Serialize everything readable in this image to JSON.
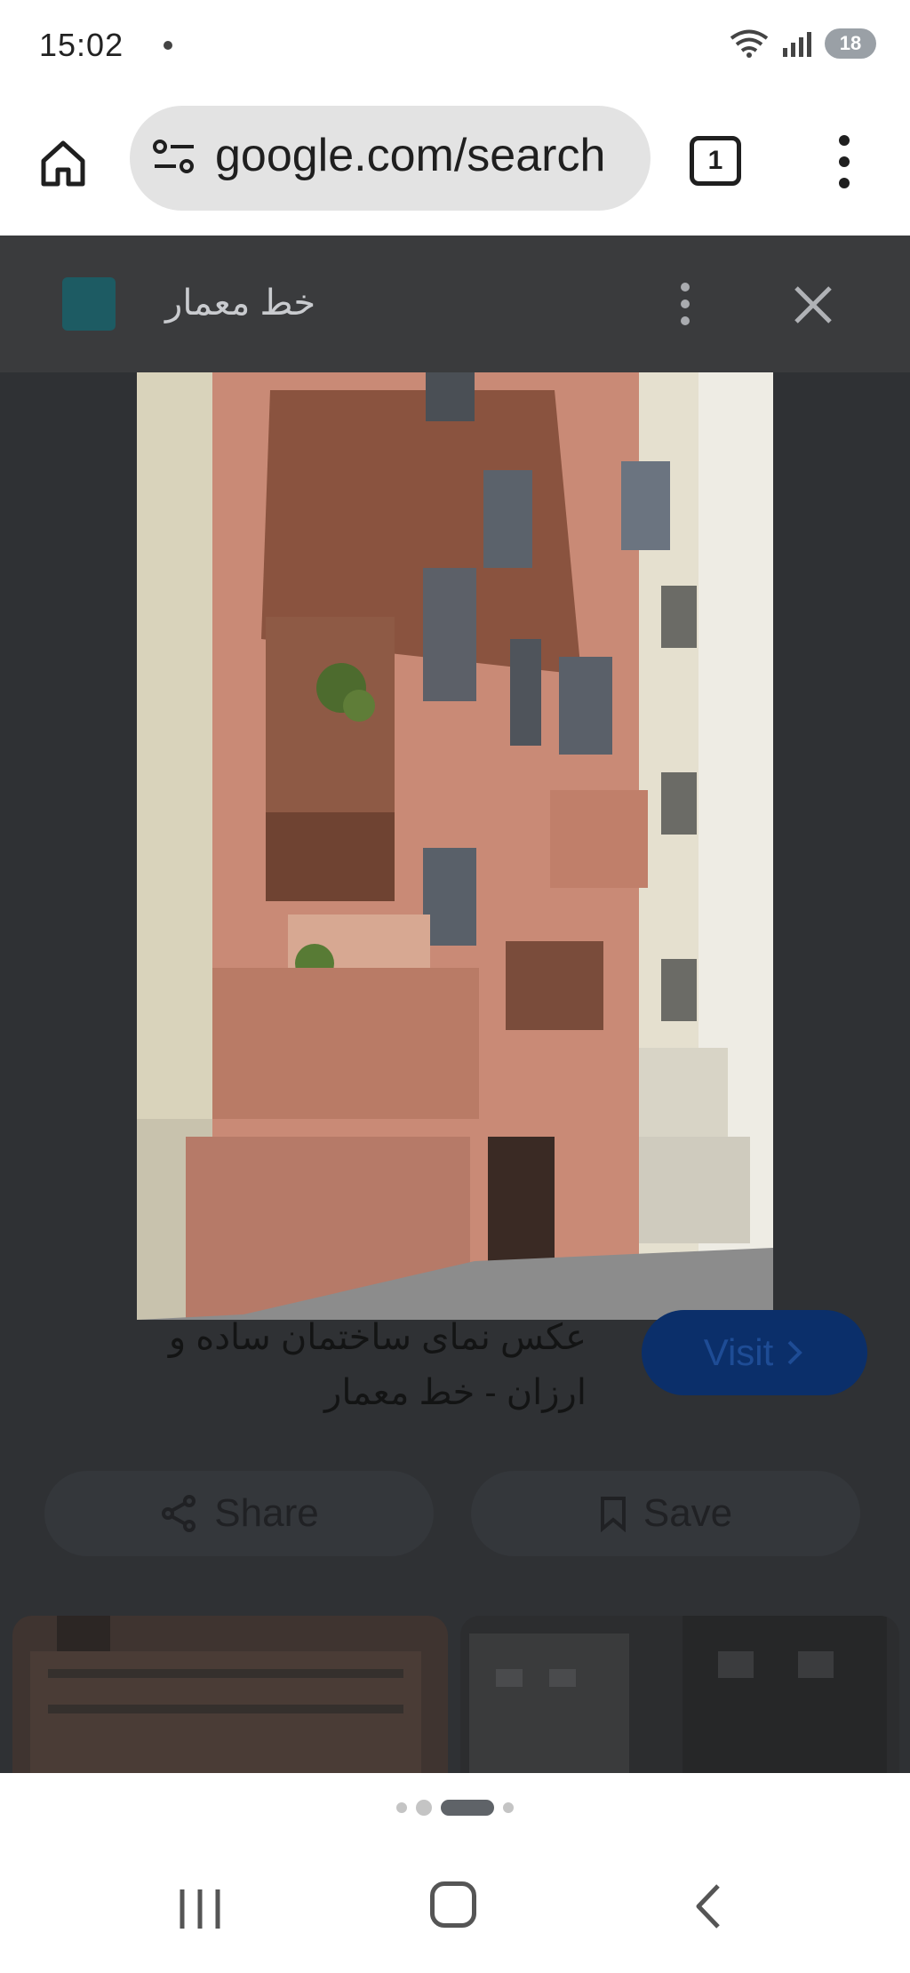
{
  "status_bar": {
    "time": "15:02",
    "battery": "18",
    "icons": [
      "wifi-icon",
      "signal-icon",
      "battery-icon"
    ]
  },
  "toolbar": {
    "url": "google.com/search",
    "tab_count": "1",
    "icons": [
      "home-icon",
      "tune-icon",
      "tab-switcher-icon",
      "more-vert-icon"
    ]
  },
  "viewer": {
    "source_name": "خط معمار",
    "title_line1": "عکس نمای ساختمان ساده و",
    "title_line2": "ارزان - خط معمار",
    "visit_label": "Visit",
    "share_label": "Share",
    "save_label": "Save",
    "icons": [
      "more-vert-icon",
      "close-icon",
      "chevron-right-icon",
      "share-icon",
      "bookmark-icon"
    ]
  },
  "pagination": {
    "count": 4,
    "active_index": 2
  },
  "colors": {
    "url_bar": "#e3e3e3",
    "dim_overlay": "#2f3134",
    "visit_button": "#0b2f6a",
    "brick": "#c98a76"
  }
}
